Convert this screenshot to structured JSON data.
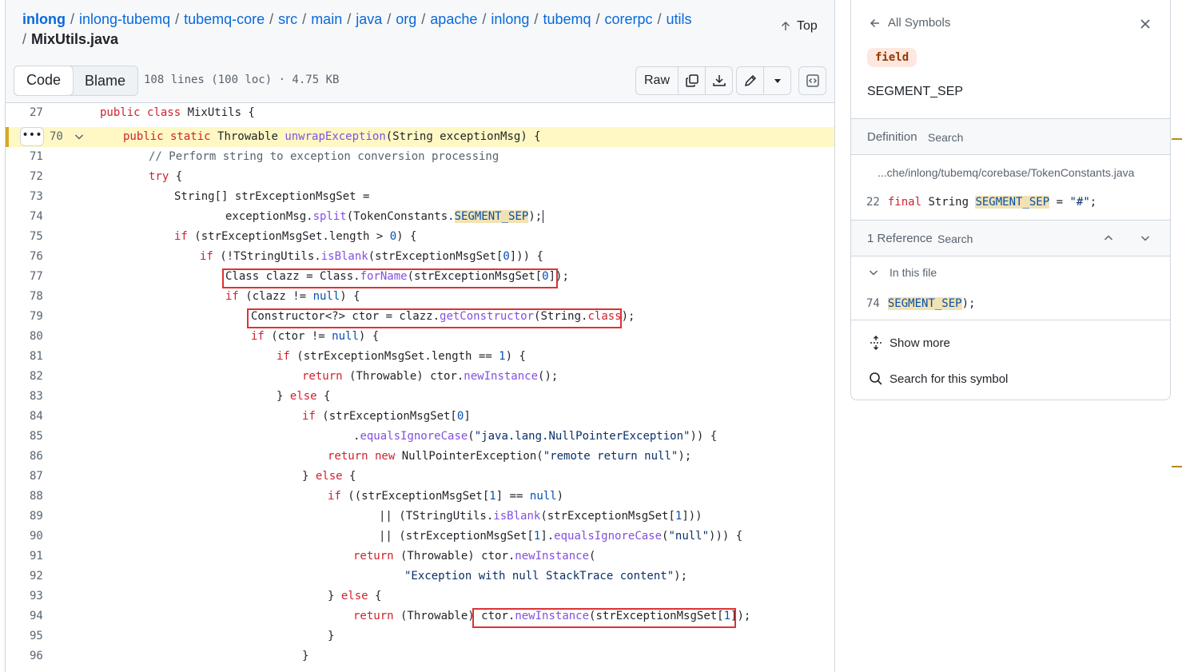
{
  "breadcrumb": {
    "parts": [
      "inlong",
      "inlong-tubemq",
      "tubemq-core",
      "src",
      "main",
      "java",
      "org",
      "apache",
      "inlong",
      "tubemq",
      "corerpc",
      "utils"
    ],
    "separator": "/",
    "file": "MixUtils.java"
  },
  "top_link": "Top",
  "view_tabs": {
    "code": "Code",
    "blame": "Blame"
  },
  "file_meta": "108 lines (100 loc) · 4.75 KB",
  "toolbar": {
    "raw": "Raw",
    "icons": [
      "copy-icon",
      "download-icon",
      "pencil-icon",
      "triangle-down-icon",
      "code-square-icon"
    ]
  },
  "gutter": {
    "expand": "•••"
  },
  "lines": [
    {
      "n": "27"
    },
    {
      "n": "70"
    },
    {
      "n": "71"
    },
    {
      "n": "72"
    },
    {
      "n": "73"
    },
    {
      "n": "74"
    },
    {
      "n": "75"
    },
    {
      "n": "76"
    },
    {
      "n": "77"
    },
    {
      "n": "78"
    },
    {
      "n": "79"
    },
    {
      "n": "80"
    },
    {
      "n": "81"
    },
    {
      "n": "82"
    },
    {
      "n": "83"
    },
    {
      "n": "84"
    },
    {
      "n": "85"
    },
    {
      "n": "86"
    },
    {
      "n": "87"
    },
    {
      "n": "88"
    },
    {
      "n": "89"
    },
    {
      "n": "90"
    },
    {
      "n": "91"
    },
    {
      "n": "92"
    },
    {
      "n": "93"
    },
    {
      "n": "94"
    },
    {
      "n": "95"
    },
    {
      "n": "96"
    }
  ],
  "code": {
    "l27": [
      "public class ",
      "MixUtils {"
    ],
    "l70": [
      "public static ",
      "Throwable ",
      "unwrapException",
      "(String exceptionMsg) {"
    ],
    "l71": "// Perform string to exception conversion processing",
    "l72": [
      "try",
      " {"
    ],
    "l73": "String[] strExceptionMsgSet =",
    "l74": [
      "exceptionMsg.",
      "split",
      "(TokenConstants.",
      "SEGMENT_SEP",
      ");"
    ],
    "l75": [
      "if",
      " (strExceptionMsgSet.length > ",
      "0",
      ") {"
    ],
    "l76": [
      "if",
      " (!TStringUtils.",
      "isBlank",
      "(strExceptionMsgSet[",
      "0",
      "])) {"
    ],
    "l77": [
      "Class clazz = Class.",
      "forName",
      "(strExceptionMsgSet[",
      "0",
      "]);"
    ],
    "l78": [
      "if",
      " (clazz != ",
      "null",
      ") {"
    ],
    "l79": [
      "Constructor<?> ctor = clazz.",
      "getConstructor",
      "(String.",
      "class",
      ");"
    ],
    "l80": [
      "if",
      " (ctor != ",
      "null",
      ") {"
    ],
    "l81": [
      "if",
      " (strExceptionMsgSet.length == ",
      "1",
      ") {"
    ],
    "l82": [
      "return",
      " (Throwable) ctor.",
      "newInstance",
      "();"
    ],
    "l83": [
      "} ",
      "else",
      " {"
    ],
    "l84": [
      "if",
      " (strExceptionMsgSet[",
      "0",
      "]"
    ],
    "l85": [
      ".",
      "equalsIgnoreCase",
      "(",
      "\"java.lang.NullPointerException\"",
      ")) {"
    ],
    "l86": [
      "return new ",
      "NullPointerException(",
      "\"remote return null\"",
      ");"
    ],
    "l87": [
      "} ",
      "else",
      " {"
    ],
    "l88": [
      "if",
      " ((strExceptionMsgSet[",
      "1",
      "] == ",
      "null",
      ")"
    ],
    "l89": [
      "|| (TStringUtils.",
      "isBlank",
      "(strExceptionMsgSet[",
      "1",
      "]))"
    ],
    "l90": [
      "|| (strExceptionMsgSet[",
      "1",
      "].",
      "equalsIgnoreCase",
      "(",
      "\"null\"",
      "))) {"
    ],
    "l91": [
      "return",
      " (Throwable) ctor.",
      "newInstance",
      "("
    ],
    "l92": [
      "\"Exception with null StackTrace content\"",
      ");"
    ],
    "l93": [
      "} ",
      "else",
      " {"
    ],
    "l94": [
      "return",
      " (Throwable) ",
      "ctor.",
      "newInstance",
      "(strExceptionMsgSet[",
      "1",
      "]);"
    ],
    "l95": "}",
    "l96": "}"
  },
  "symbols": {
    "back": "All Symbols",
    "kind": "field",
    "name": "SEGMENT_SEP",
    "definition": {
      "title": "Definition",
      "search": "Search",
      "path": "...che/inlong/tubemq/corebase/TokenConstants.java",
      "line_no": "22",
      "code": [
        "final",
        " String ",
        "SEGMENT_SEP",
        " = ",
        "\"#\"",
        ";"
      ]
    },
    "references": {
      "title": "1 Reference",
      "search": "Search",
      "group": "In this file",
      "line_no": "74",
      "code": [
        "SEGMENT_SEP",
        ");"
      ]
    },
    "show_more": "Show more",
    "search_symbol": "Search for this symbol"
  },
  "colors": {
    "link": "#0969da",
    "keyword": "#cf222e",
    "function": "#8250df",
    "highlight_row": "#fff8c5",
    "annotation_box": "#e03131"
  }
}
